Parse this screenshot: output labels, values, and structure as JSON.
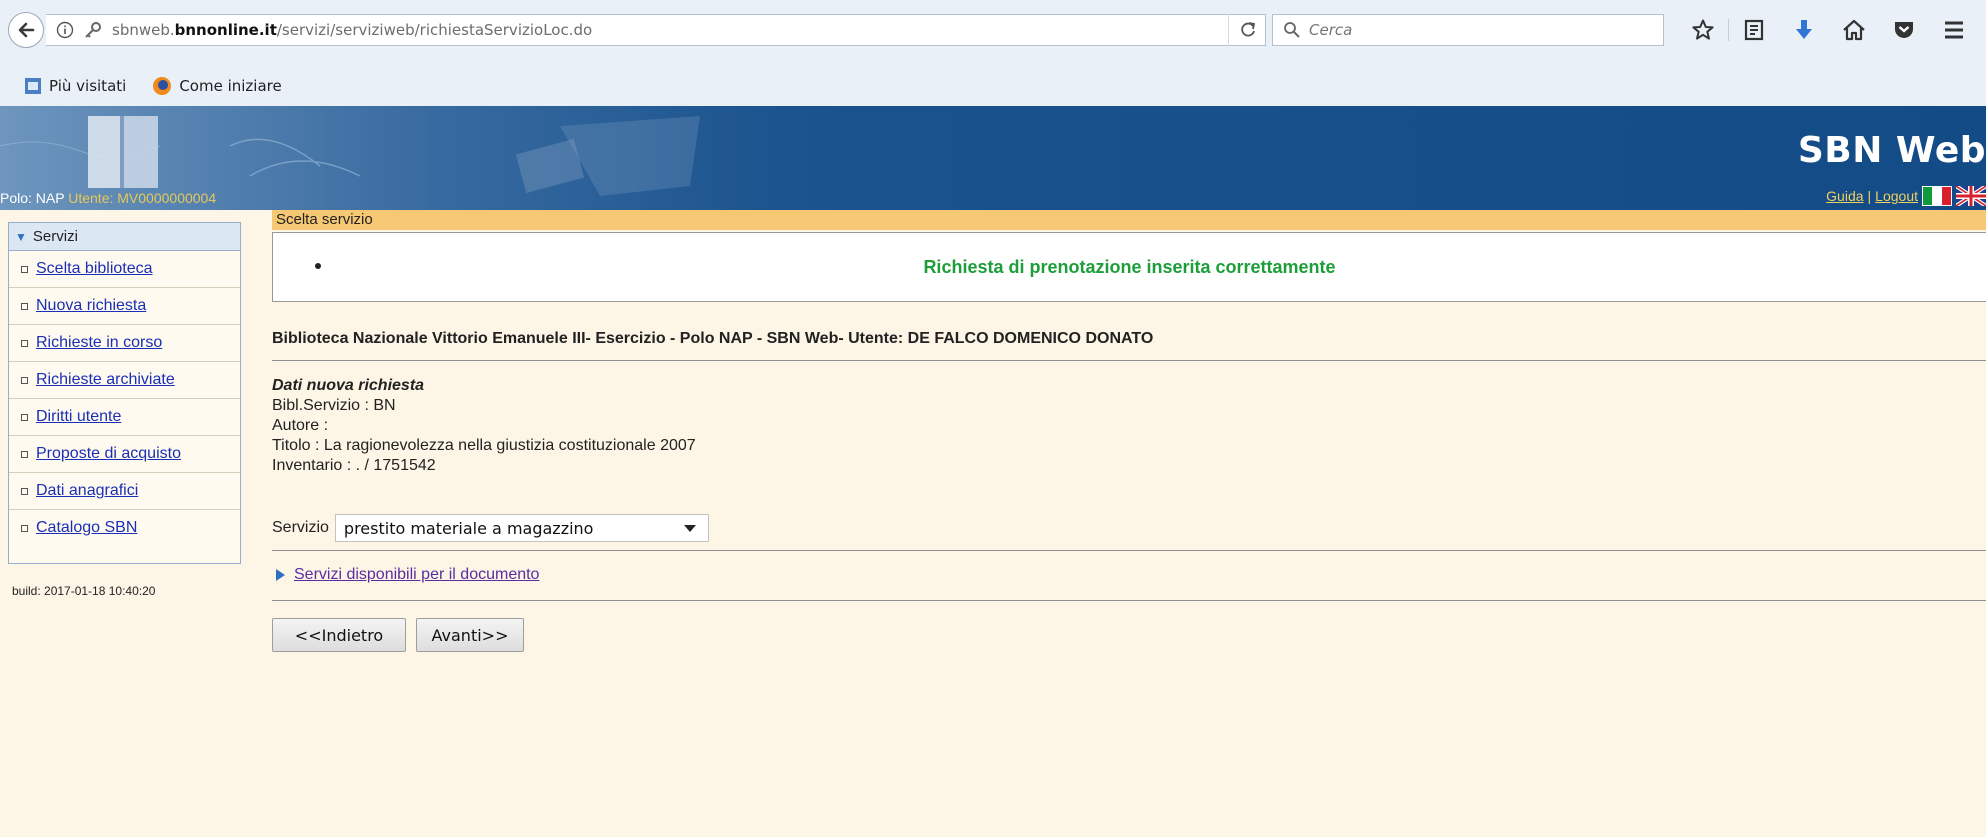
{
  "browser": {
    "url_prefix": "sbnweb.",
    "url_domain": "bnnonline.it",
    "url_path": "/servizi/serviziweb/richiestaServizioLoc.do",
    "search_placeholder": "Cerca",
    "bookmarks": [
      {
        "label": "Più visitati",
        "icon": "bookmark-page-icon"
      },
      {
        "label": "Come iniziare",
        "icon": "firefox-icon"
      }
    ],
    "toolbar_icons": [
      "star-icon",
      "reading-list-icon",
      "download-icon",
      "home-icon",
      "pocket-icon",
      "menu-icon"
    ]
  },
  "banner": {
    "title": "SBN Web",
    "polo_label": "Polo: NAP",
    "user_label": "Utente: MV0000000004",
    "guida": "Guida",
    "logout": "Logout",
    "colors": {
      "banner": "#134b87",
      "link": "#f0d060"
    }
  },
  "sidebar": {
    "header": "Servizi",
    "items": [
      {
        "label": "Scelta biblioteca"
      },
      {
        "label": "Nuova richiesta"
      },
      {
        "label": "Richieste in corso"
      },
      {
        "label": "Richieste archiviate"
      },
      {
        "label": "Diritti utente"
      },
      {
        "label": "Proposte di acquisto"
      },
      {
        "label": "Dati anagrafici"
      },
      {
        "label": "Catalogo SBN"
      }
    ],
    "build": "build: 2017-01-18 10:40:20"
  },
  "main": {
    "tab_title": "Scelta servizio",
    "message": "Richiesta di prenotazione inserita correttamente",
    "library_line": "Biblioteca Nazionale Vittorio Emanuele III- Esercizio - Polo NAP - SBN Web- Utente: DE FALCO DOMENICO DONATO",
    "details": {
      "heading": "Dati nuova richiesta",
      "bibl_servizio": "Bibl.Servizio : BN",
      "autore": "Autore :",
      "titolo": "Titolo : La ragionevolezza nella giustizia costituzionale 2007",
      "inventario": "Inventario : . / 1751542"
    },
    "service_label": "Servizio",
    "service_value": "prestito materiale a magazzino",
    "available_link": "Servizi disponibili per il documento",
    "back_button": "<<Indietro",
    "next_button": "Avanti>>",
    "colors": {
      "success": "#1e9e3a",
      "tab": "#f7c873",
      "link": "#1a2fb5"
    }
  }
}
